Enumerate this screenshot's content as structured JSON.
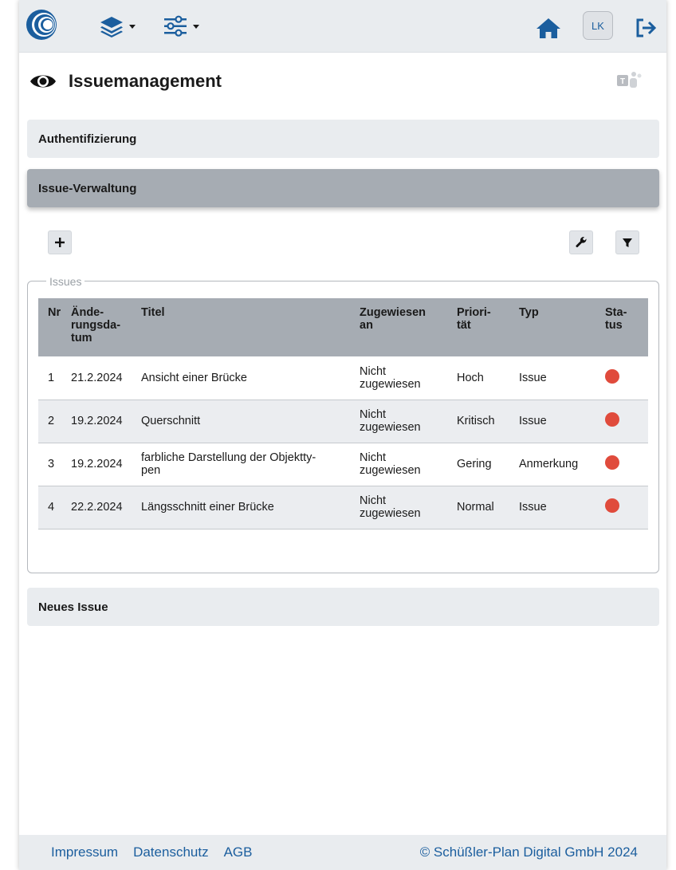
{
  "topbar": {
    "logo": "app-logo",
    "layers_icon": "layers-icon",
    "settings_icon": "sliders-icon",
    "home_icon": "home-icon",
    "user_initials": "LK",
    "logout_icon": "logout-icon"
  },
  "page": {
    "title": "Issuemanagement",
    "title_icon": "eye-icon",
    "teams_icon": "teams-icon"
  },
  "accordion": {
    "auth": "Authentifizierung",
    "issues": "Issue-Verwaltung",
    "new_issue": "Neues Issue"
  },
  "toolbar": {
    "add_icon": "plus-icon",
    "wrench_icon": "wrench-icon",
    "filter_icon": "filter-icon"
  },
  "issues": {
    "legend": "Issues",
    "columns": {
      "nr": "Nr",
      "date": "Ände-\nrungsda-\ntum",
      "title": "Titel",
      "assigned": "Zugewiesen\nan",
      "priority": "Priori-\ntät",
      "type": "Typ",
      "status": "Sta-\ntus"
    },
    "rows": [
      {
        "nr": "1",
        "date": "21.2.2024",
        "title": "Ansicht einer Brücke",
        "assigned": "Nicht\nzugewiesen",
        "priority": "Hoch",
        "type": "Issue"
      },
      {
        "nr": "2",
        "date": "19.2.2024",
        "title": "Querschnitt",
        "assigned": "Nicht\nzugewiesen",
        "priority": "Kritisch",
        "type": "Issue"
      },
      {
        "nr": "3",
        "date": "19.2.2024",
        "title": "farbliche Darstellung der Objektty-\npen",
        "assigned": "Nicht\nzugewiesen",
        "priority": "Gering",
        "type": "Anmerkung"
      },
      {
        "nr": "4",
        "date": "22.2.2024",
        "title": "Längsschnitt einer Brücke",
        "assigned": "Nicht\nzugewiesen",
        "priority": "Normal",
        "type": "Issue"
      }
    ],
    "status_color": "#e04b3c"
  },
  "footer": {
    "impressum": "Impressum",
    "datenschutz": "Datenschutz",
    "agb": "AGB",
    "copyright": "© Schüßler-Plan Digital GmbH 2024"
  },
  "colors": {
    "accent": "#1b5e9e",
    "active_panel": "#a6acb3",
    "panel": "#e9ecef"
  }
}
